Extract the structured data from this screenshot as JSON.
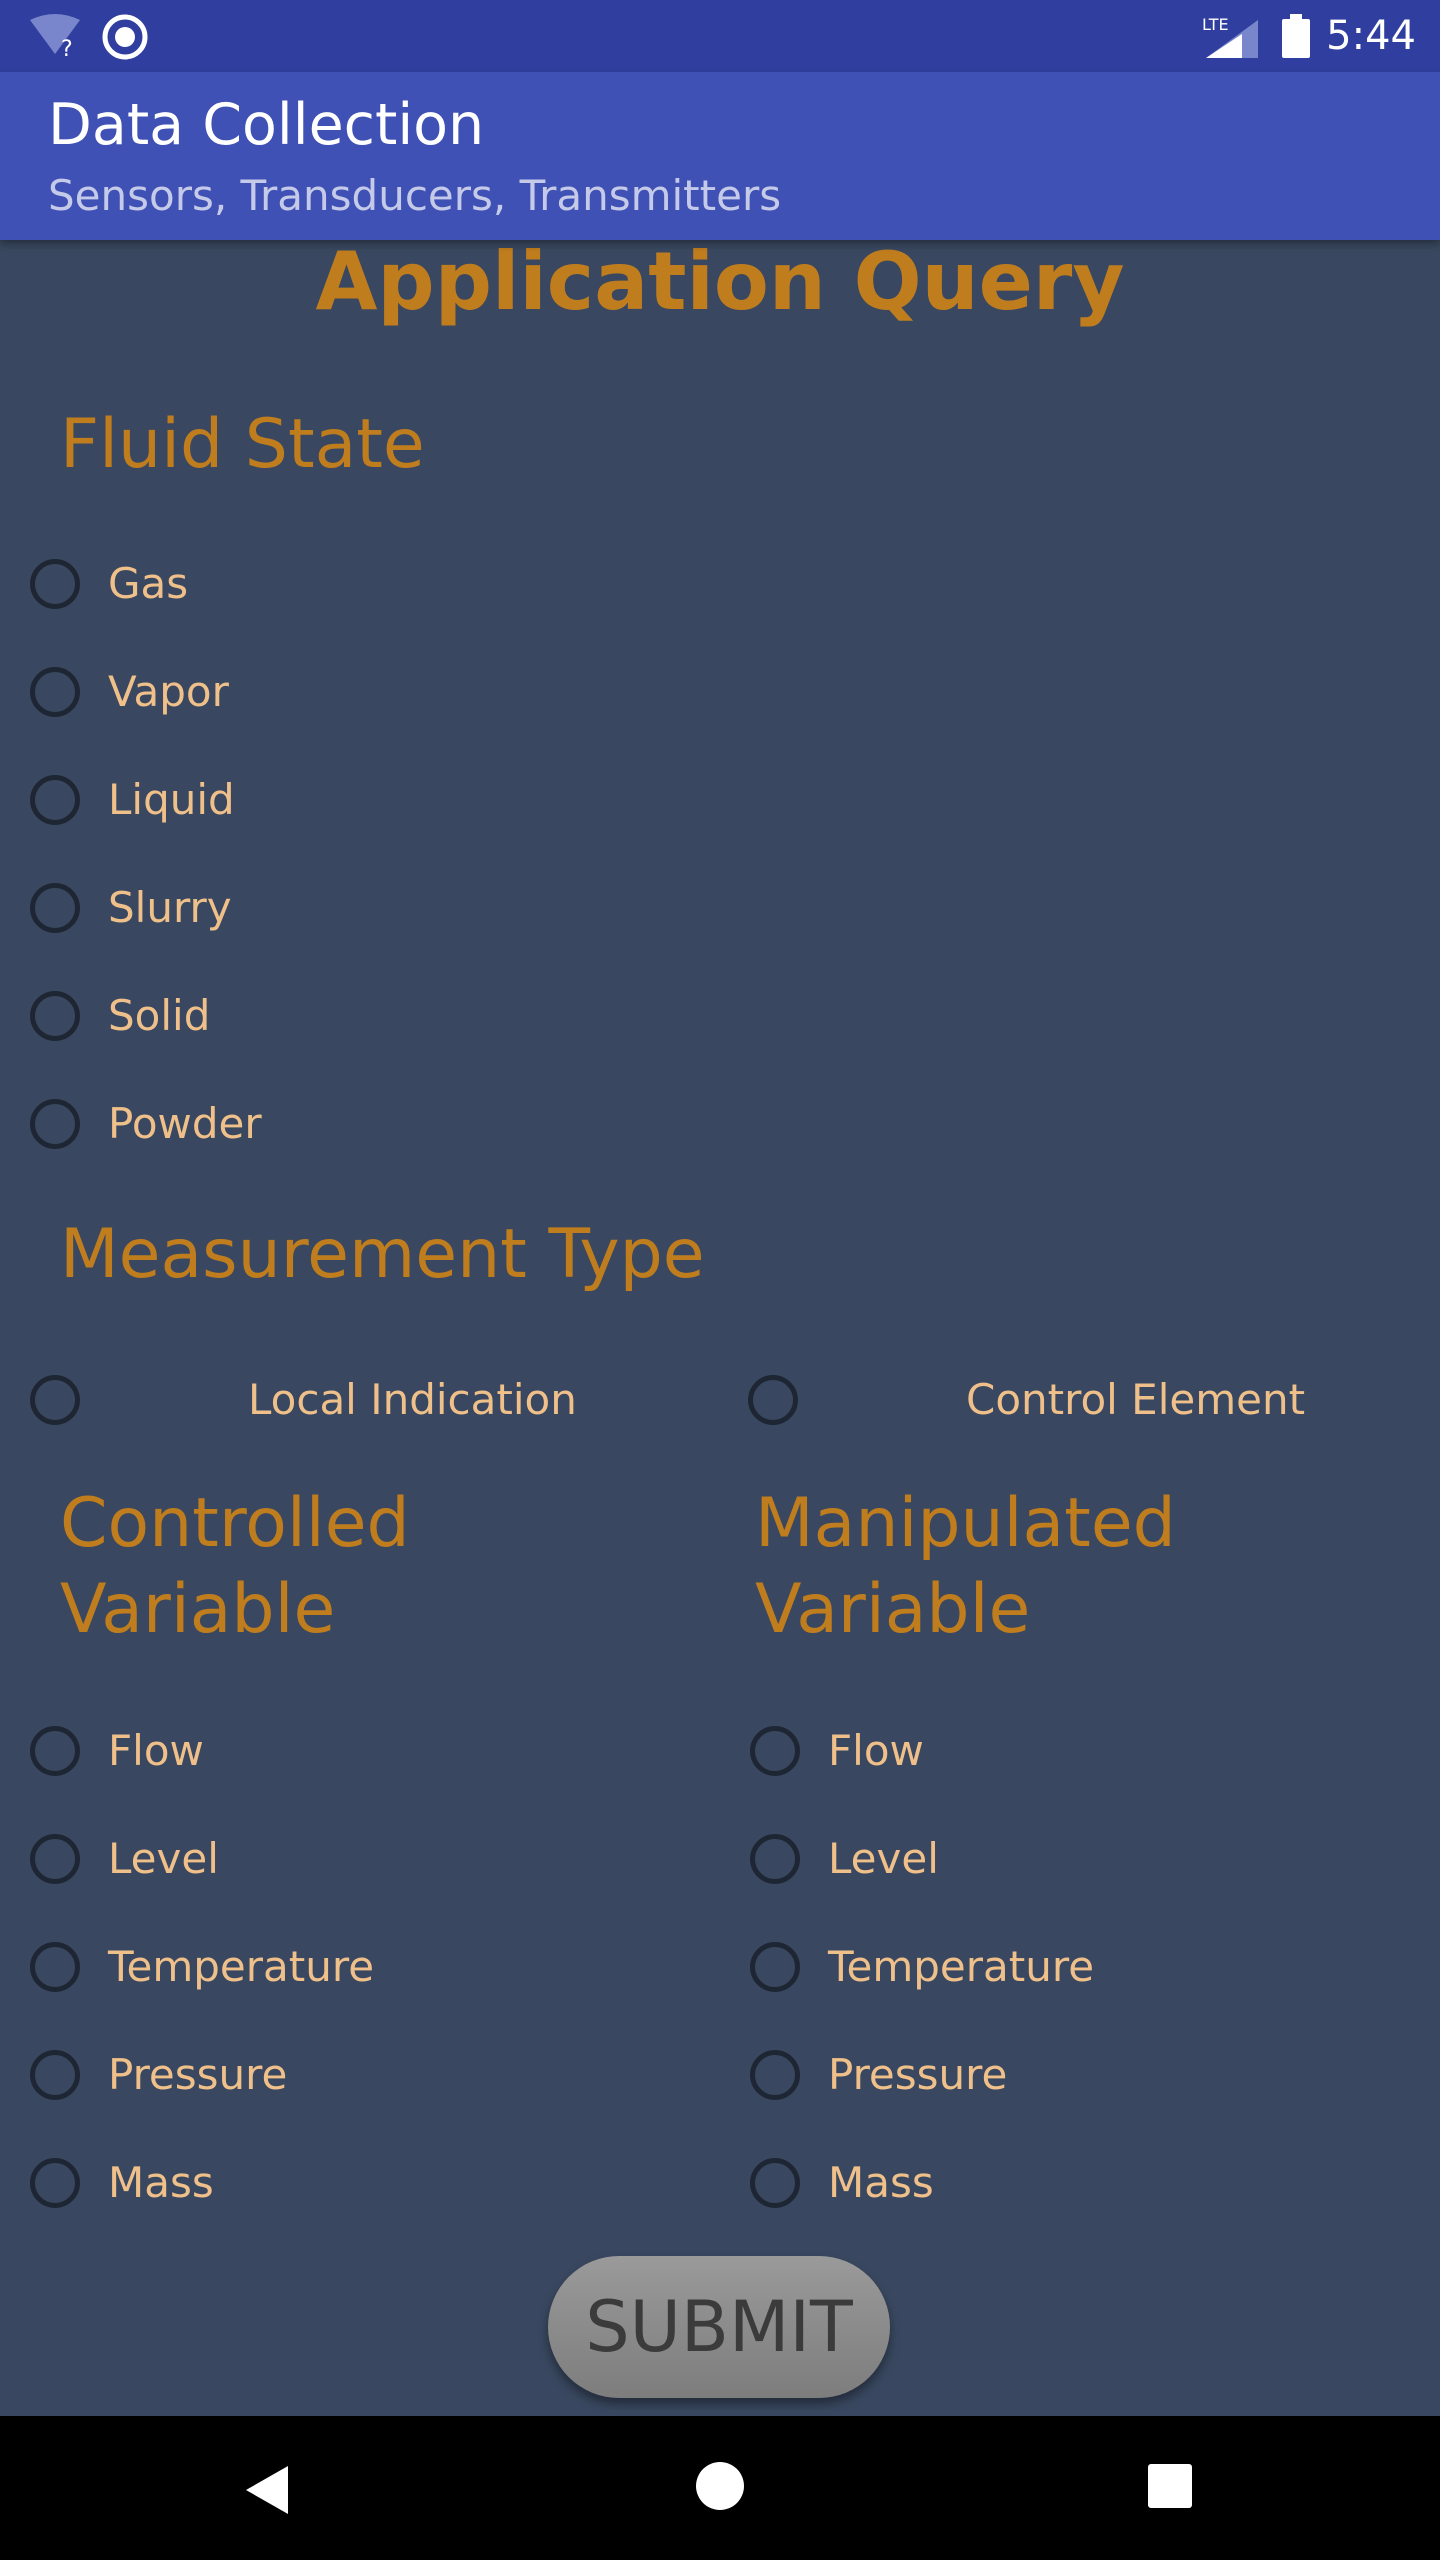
{
  "status_bar": {
    "time": "5:44",
    "icons": [
      "wifi-unknown-icon",
      "record-icon",
      "lte-signal-icon",
      "battery-icon"
    ],
    "lte_label": "LTE"
  },
  "app_bar": {
    "title": "Data Collection",
    "subtitle": "Sensors, Transducers, Transmitters"
  },
  "main": {
    "title": "Application Query",
    "fluid_state": {
      "heading": "Fluid State",
      "options": [
        "Gas",
        "Vapor",
        "Liquid",
        "Slurry",
        "Solid",
        "Powder"
      ]
    },
    "measurement_type": {
      "heading": "Measurement Type",
      "options": [
        "Local Indication",
        "Control Element"
      ]
    },
    "controlled_variable": {
      "heading_line1": "Controlled",
      "heading_line2": "Variable",
      "options": [
        "Flow",
        "Level",
        "Temperature",
        "Pressure",
        "Mass"
      ]
    },
    "manipulated_variable": {
      "heading_line1": "Manipulated",
      "heading_line2": "Variable",
      "options": [
        "Flow",
        "Level",
        "Temperature",
        "Pressure",
        "Mass"
      ]
    },
    "submit_label": "SUBMIT"
  },
  "nav_bar": {
    "icons": [
      "back-icon",
      "home-icon",
      "recents-icon"
    ]
  },
  "colors": {
    "status_bar": "#303F9F",
    "app_bar": "#3F51B5",
    "background": "#394860",
    "heading": "#C07D1E",
    "option_text": "#F0C08A",
    "radio_border": "#1E2634"
  }
}
